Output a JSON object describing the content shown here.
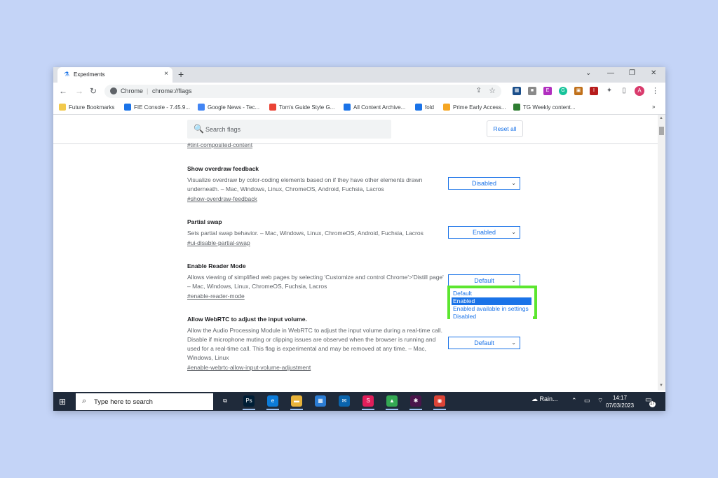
{
  "tab": {
    "title": "Experiments",
    "close": "×",
    "new_tab": "+"
  },
  "window_controls": {
    "search_tabs": "⌄",
    "minimize": "—",
    "restore": "❐",
    "close": "✕"
  },
  "toolbar": {
    "back": "←",
    "forward": "→",
    "reload": "↻",
    "chip": "Chrome",
    "sep": "|",
    "url": "chrome://flags",
    "share": "⇪",
    "star": "☆",
    "extensions": [
      "▦",
      "■",
      "E",
      "G",
      "▣",
      "I",
      "✦",
      "▯"
    ],
    "avatar": "A",
    "menu": "⋮"
  },
  "bookmarks": [
    {
      "label": "Future Bookmarks",
      "icon": "folder-icon",
      "color": "#f2c94c"
    },
    {
      "label": "FIE Console - 7.45.9...",
      "icon": "console-icon",
      "color": "#1a73e8"
    },
    {
      "label": "Google News - Tec...",
      "icon": "news-icon",
      "color": "#4285f4"
    },
    {
      "label": "Tom's Guide Style G...",
      "icon": "google-icon",
      "color": "#ea4335"
    },
    {
      "label": "All Content Archive...",
      "icon": "tumblr-icon",
      "color": "#1a73e8"
    },
    {
      "label": "fold",
      "icon": "tumblr-icon",
      "color": "#1a73e8"
    },
    {
      "label": "Prime Early Access...",
      "icon": "prime-icon",
      "color": "#f5a623"
    },
    {
      "label": "TG Weekly content...",
      "icon": "plus-icon",
      "color": "#2e7d32"
    }
  ],
  "bookmarks_more": "»",
  "flags_page": {
    "search_placeholder": "Search flags",
    "search_icon": "🔍",
    "reset_label": "Reset all",
    "prev_link": "#tint-composited-content",
    "flags": [
      {
        "title": "Show overdraw feedback",
        "desc": "Visualize overdraw by color-coding elements based on if they have other elements drawn underneath. – Mac, Windows, Linux, ChromeOS, Android, Fuchsia, Lacros",
        "link": "#show-overdraw-feedback",
        "value": "Disabled"
      },
      {
        "title": "Partial swap",
        "desc": "Sets partial swap behavior. – Mac, Windows, Linux, ChromeOS, Android, Fuchsia, Lacros",
        "link": "#ui-disable-partial-swap",
        "value": "Enabled"
      },
      {
        "title": "Enable Reader Mode",
        "desc": "Allows viewing of simplified web pages by selecting 'Customize and control Chrome'>'Distill page' – Mac, Windows, Linux, ChromeOS, Fuchsia, Lacros",
        "link": "#enable-reader-mode",
        "value": "Default"
      },
      {
        "title": "Allow WebRTC to adjust the input volume.",
        "desc": "Allow the Audio Processing Module in WebRTC to adjust the input volume during a real-time call. Disable if microphone muting or clipping issues are observed when the browser is running and used for a real-time call. This flag is experimental and may be removed at any time. – Mac, Windows, Linux",
        "link": "#enable-webrtc-allow-input-volume-adjustment",
        "value": "Default"
      }
    ],
    "dropdown_options": [
      "Default",
      "Enabled",
      "Enabled available in settings",
      "Disabled"
    ],
    "dropdown_selected": "Enabled",
    "chevron": "⌄"
  },
  "scrollbar": {
    "up": "▲",
    "down": "▼"
  },
  "taskbar": {
    "start_icon": "⊞",
    "search_placeholder": "Type here to search",
    "search_icon": "⌕",
    "apps": [
      {
        "name": "task-view-icon",
        "glyph": "⧉",
        "color": "#1f2a3a"
      },
      {
        "name": "photoshop-icon",
        "glyph": "Ps",
        "color": "#001e36"
      },
      {
        "name": "edge-icon",
        "glyph": "e",
        "color": "#0c7bd8"
      },
      {
        "name": "file-explorer-icon",
        "glyph": "▬",
        "color": "#e8b33a"
      },
      {
        "name": "store-icon",
        "glyph": "▦",
        "color": "#2b7cd3"
      },
      {
        "name": "mail-icon",
        "glyph": "✉",
        "color": "#0a64ad"
      },
      {
        "name": "slack-icon",
        "glyph": "S",
        "color": "#e01e5a"
      },
      {
        "name": "drive-icon",
        "glyph": "▲",
        "color": "#34a853"
      },
      {
        "name": "slack-alt-icon",
        "glyph": "✱",
        "color": "#4a154b"
      },
      {
        "name": "chrome-icon",
        "glyph": "◉",
        "color": "#db4437"
      }
    ],
    "weather": "☁ Rain...",
    "tray": "⌃ ▭ ⌔",
    "time": "14:17",
    "date": "07/03/2023",
    "notif_icon": "▭",
    "notif_count": "17"
  }
}
